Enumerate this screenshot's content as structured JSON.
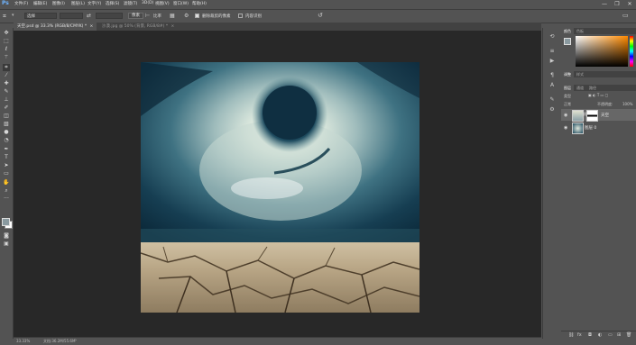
{
  "app": {
    "logo": "Ps",
    "menus": [
      "文件(F)",
      "编辑(E)",
      "图像(I)",
      "图层(L)",
      "文字(Y)",
      "选择(S)",
      "滤镜(T)",
      "3D(D)",
      "视图(V)",
      "窗口(W)",
      "帮助(H)"
    ],
    "window_controls": [
      "—",
      "❐",
      "✕"
    ]
  },
  "options": {
    "style_label": "选择",
    "field2": "",
    "field3": "",
    "width_label": "像素",
    "ratio_label": "比率",
    "sample_label": "删除裁剪的像素",
    "content_btn": "内容识别"
  },
  "tabs": [
    {
      "label": "天空.psd @ 33.3% (RGB/8/CMYK) *",
      "close": "×"
    },
    {
      "label": "沙漠.jpg @ 50% (背景, RGB/8#) *",
      "close": "×"
    }
  ],
  "status": {
    "zoom": "33.33%",
    "doc": "文档:36.2M/55.6M"
  },
  "tools": [
    "move-tool",
    "marquee-tool",
    "lasso-tool",
    "magic-wand-tool",
    "crop-tool",
    "eyedropper-tool",
    "healing-tool",
    "brush-tool",
    "stamp-tool",
    "history-brush-tool",
    "eraser-tool",
    "gradient-tool",
    "blur-tool",
    "dodge-tool",
    "pen-tool",
    "type-tool",
    "path-select-tool",
    "shape-tool",
    "hand-tool",
    "zoom-tool",
    "more-tool"
  ],
  "panel": {
    "color_tabs": [
      "颜色",
      "色板"
    ],
    "adjust_tabs": [
      "调整",
      "样式"
    ],
    "layer_tabs": [
      "图层",
      "通道",
      "路径"
    ],
    "kind_label": "类型",
    "blend_mode": "正常",
    "opacity_label": "不透明度:",
    "opacity_value": "100%",
    "lock_label": "锁定:",
    "fill_label": "填充:",
    "fill_value": "100%",
    "layers": [
      {
        "name": "天空",
        "selected": true
      },
      {
        "name": "图层 0",
        "selected": false
      }
    ]
  },
  "colors": {
    "foreground": "#8a9aa0",
    "background": "#ffffff",
    "picker_hue": "#ff8a00",
    "accent": "#2d8ceb"
  }
}
